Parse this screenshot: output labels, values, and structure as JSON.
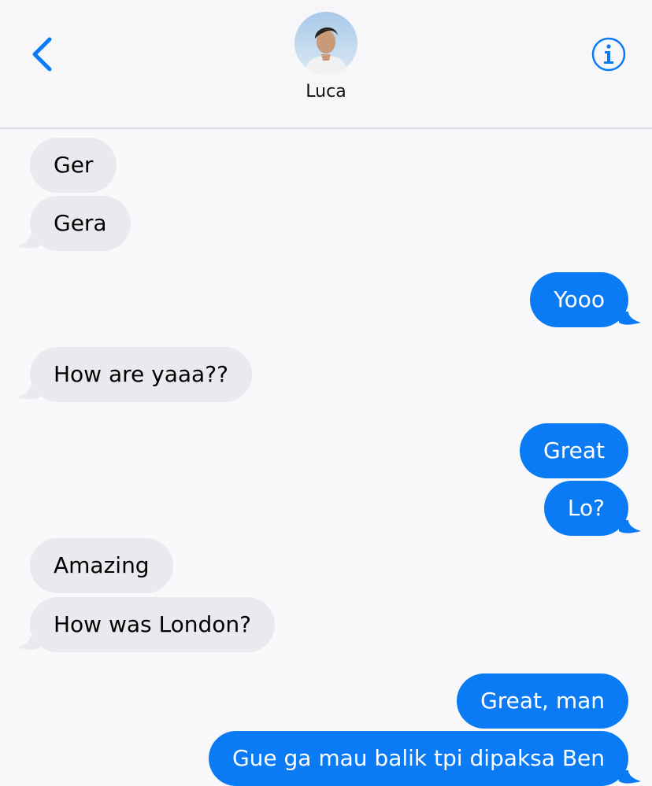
{
  "header": {
    "contact_name": "Luca"
  },
  "icons": {
    "back": "chevron-left-icon",
    "info": "info-icon"
  },
  "colors": {
    "outgoing_bubble": "#0a7bf5",
    "incoming_bubble": "#e9e9ee",
    "accent": "#0a7bf5"
  },
  "messages": [
    {
      "sender": "them",
      "text": "Ger"
    },
    {
      "sender": "them",
      "text": "Gera"
    },
    {
      "sender": "me",
      "text": "Yooo"
    },
    {
      "sender": "them",
      "text": "How are yaaa??"
    },
    {
      "sender": "me",
      "text": "Great"
    },
    {
      "sender": "me",
      "text": "Lo?"
    },
    {
      "sender": "them",
      "text": "Amazing"
    },
    {
      "sender": "them",
      "text": "How was London?"
    },
    {
      "sender": "me",
      "text": "Great, man"
    },
    {
      "sender": "me",
      "text": "Gue ga mau balik tpi dipaksa Ben"
    }
  ]
}
